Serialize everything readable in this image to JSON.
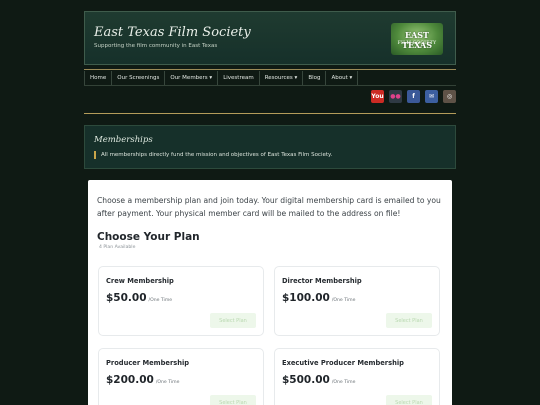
{
  "header": {
    "title": "East Texas Film Society",
    "tagline": "Supporting the film community in East Texas",
    "logo": {
      "line1": "EAST TEXAS",
      "line2": "FILM SOCIETY"
    }
  },
  "nav": {
    "items": [
      "Home",
      "Our Screenings",
      "Our Members ▾",
      "Livestream",
      "Resources ▾",
      "Blog",
      "About ▾"
    ]
  },
  "social": [
    {
      "icon": "youtube-icon",
      "label": "You",
      "color": "#cc2b24"
    },
    {
      "icon": "flickr-icon",
      "label": "●●",
      "color": "#2f3a44"
    },
    {
      "icon": "facebook-icon",
      "label": "f",
      "color": "#3b5998"
    },
    {
      "icon": "email-icon",
      "label": "✉",
      "color": "#3c5fa0"
    },
    {
      "icon": "instagram-icon",
      "label": "◎",
      "color": "#5e5247"
    }
  ],
  "banner": {
    "title": "Memberships",
    "text": "All memberships directly fund the mission and objectives of East Texas Film Society."
  },
  "main": {
    "intro": "Choose a membership plan and join today. Your digital membership card is emailed to you after payment. Your physical member card will be mailed to the address on file!",
    "plans_heading": "Choose Your Plan",
    "plans_count": "4 Plan Available",
    "plans": [
      {
        "name": "Crew Membership",
        "price": "$50.00",
        "unit": "/One Time",
        "button": "Select Plan"
      },
      {
        "name": "Director Membership",
        "price": "$100.00",
        "unit": "/One Time",
        "button": "Select Plan"
      },
      {
        "name": "Producer Membership",
        "price": "$200.00",
        "unit": "/One Time",
        "button": "Select Plan"
      },
      {
        "name": "Executive Producer Membership",
        "price": "$500.00",
        "unit": "/One Time",
        "button": "Select Plan"
      }
    ]
  }
}
